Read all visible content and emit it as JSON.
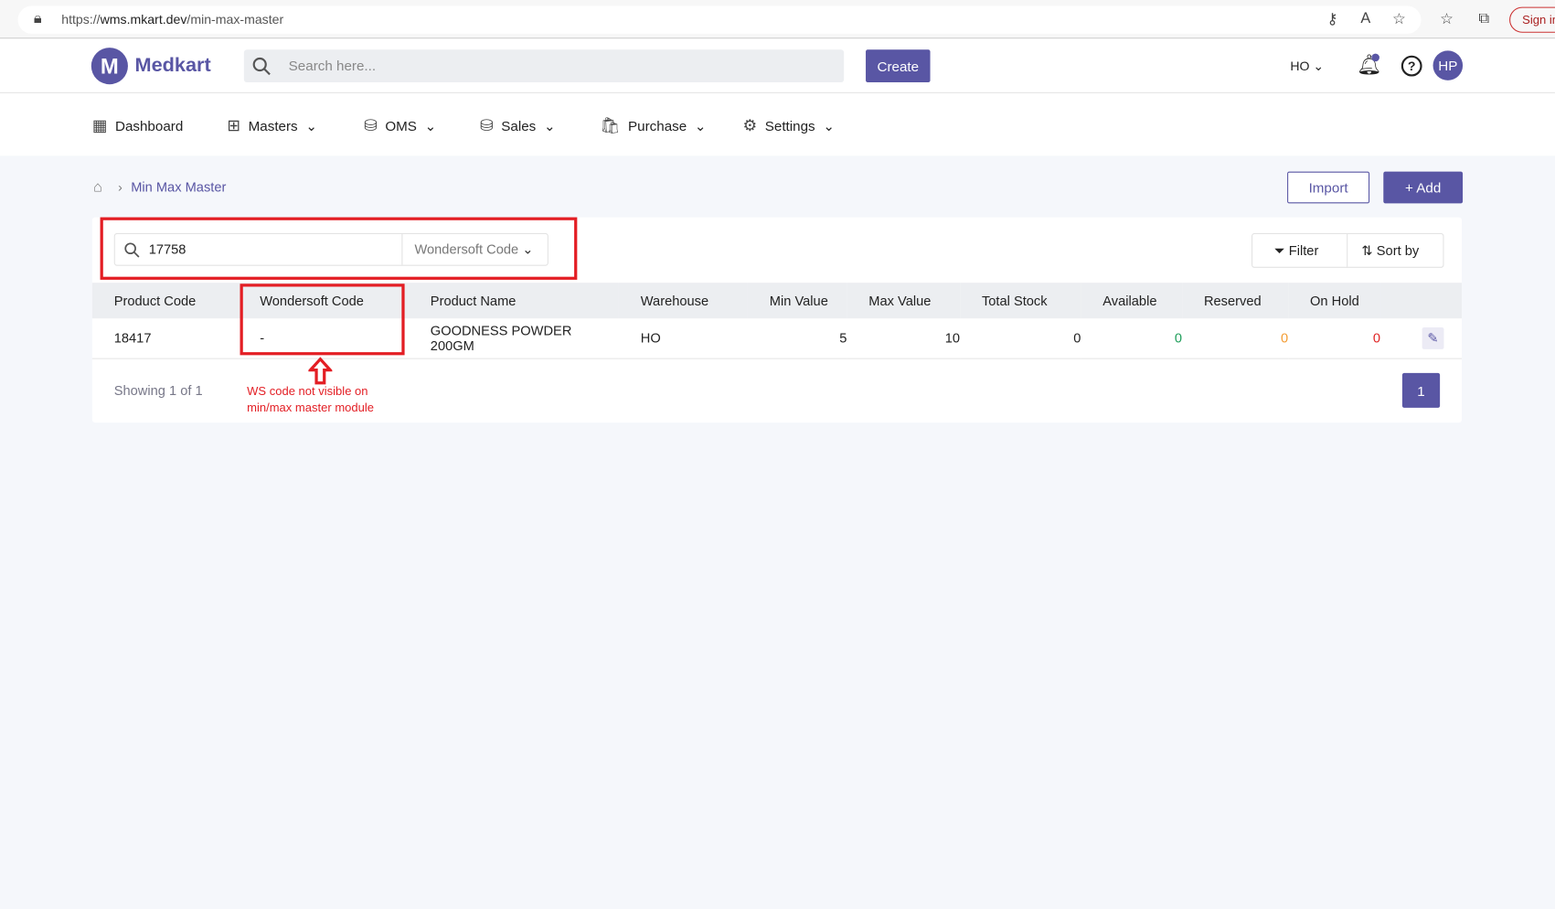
{
  "browser": {
    "url_prefix": "https://",
    "url_host": "wms.mkart.dev",
    "url_path": "/min-max-master",
    "sign_in": "Sign in"
  },
  "header": {
    "logo_letter": "M",
    "brand": "Medkart",
    "search_placeholder": "Search here...",
    "create": "Create",
    "location": "HO",
    "avatar": "HP"
  },
  "nav": [
    {
      "label": "Dashboard",
      "icon": "dashboard-icon"
    },
    {
      "label": "Masters",
      "icon": "hierarchy-icon"
    },
    {
      "label": "OMS",
      "icon": "oms-icon"
    },
    {
      "label": "Sales",
      "icon": "sales-icon"
    },
    {
      "label": "Purchase",
      "icon": "bag-icon"
    },
    {
      "label": "Settings",
      "icon": "gear-icon"
    }
  ],
  "breadcrumb": {
    "current": "Min Max Master"
  },
  "actions": {
    "import": "Import",
    "add": "+ Add"
  },
  "filters": {
    "search_value": "17758",
    "search_field": "Wondersoft Code",
    "filter": "Filter",
    "sort": "Sort by"
  },
  "table": {
    "headers": [
      "Product Code",
      "Wondersoft Code",
      "Product Name",
      "Warehouse",
      "Min Value",
      "Max Value",
      "Total Stock",
      "Available",
      "Reserved",
      "On Hold"
    ],
    "rows": [
      [
        "18417",
        "-",
        "GOODNESS POWDER 200GM",
        "HO",
        "5",
        "10",
        "0",
        "0",
        "0",
        "0"
      ]
    ]
  },
  "footer": {
    "showing": "Showing 1 of 1",
    "page": "1"
  },
  "annotation": {
    "line1": "WS code not visible on",
    "line2": "min/max master module"
  },
  "colors": {
    "primary": "#5956a4",
    "available": "#1e9e5a",
    "reserved": "#f39c32",
    "on_hold": "#e02424",
    "annotation": "#e31e24"
  }
}
